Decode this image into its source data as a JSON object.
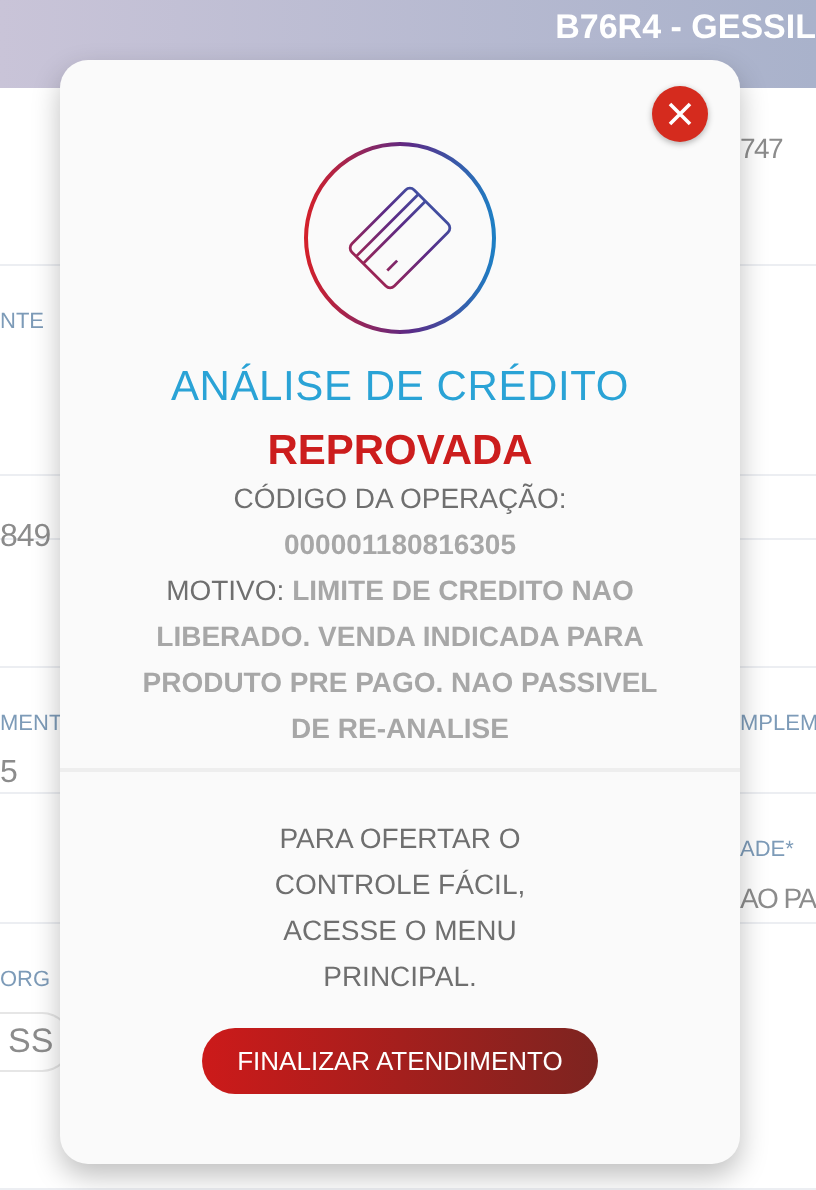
{
  "header": {
    "title": "B76R4 - GESSIL"
  },
  "form_rows": [
    {
      "left": [],
      "right": [
        {
          "kind": "value",
          "text": "747"
        }
      ]
    },
    {
      "left": [
        {
          "kind": "label",
          "text": "NTE"
        }
      ],
      "right": []
    },
    {
      "left": [
        {
          "kind": "value",
          "text": "849"
        }
      ],
      "right": []
    },
    {
      "left": [],
      "right": []
    },
    {
      "left": [
        {
          "kind": "label",
          "text": "MENT"
        },
        {
          "kind": "value",
          "text": "5"
        }
      ],
      "right": [
        {
          "kind": "label",
          "text": "MPLEM"
        }
      ]
    },
    {
      "left": [],
      "right": [
        {
          "kind": "label",
          "text": "ADE*"
        },
        {
          "kind": "value",
          "text": "AO PA"
        }
      ]
    },
    {
      "left": [
        {
          "kind": "label",
          "text": "ORG"
        },
        {
          "kind": "field",
          "text": "SS"
        }
      ],
      "right": []
    }
  ],
  "dialog": {
    "title": "ANÁLISE DE CRÉDITO",
    "status": "REPROVADA",
    "code_label": "CÓDIGO DA OPERAÇÃO:",
    "code": "000001180816305",
    "reason": "MOTIVO: **LIMITE DE CREDITO NAO LIBERADO. VENDA INDICADA PARA PRODUTO PRE PAGO. NAO PASSIVEL DE RE-ANALISE**",
    "message": "PARA OFERTAR O CONTROLE FÁCIL, ACESSE O MENU PRINCIPAL.",
    "button": "FINALIZAR ATENDIMENTO"
  }
}
